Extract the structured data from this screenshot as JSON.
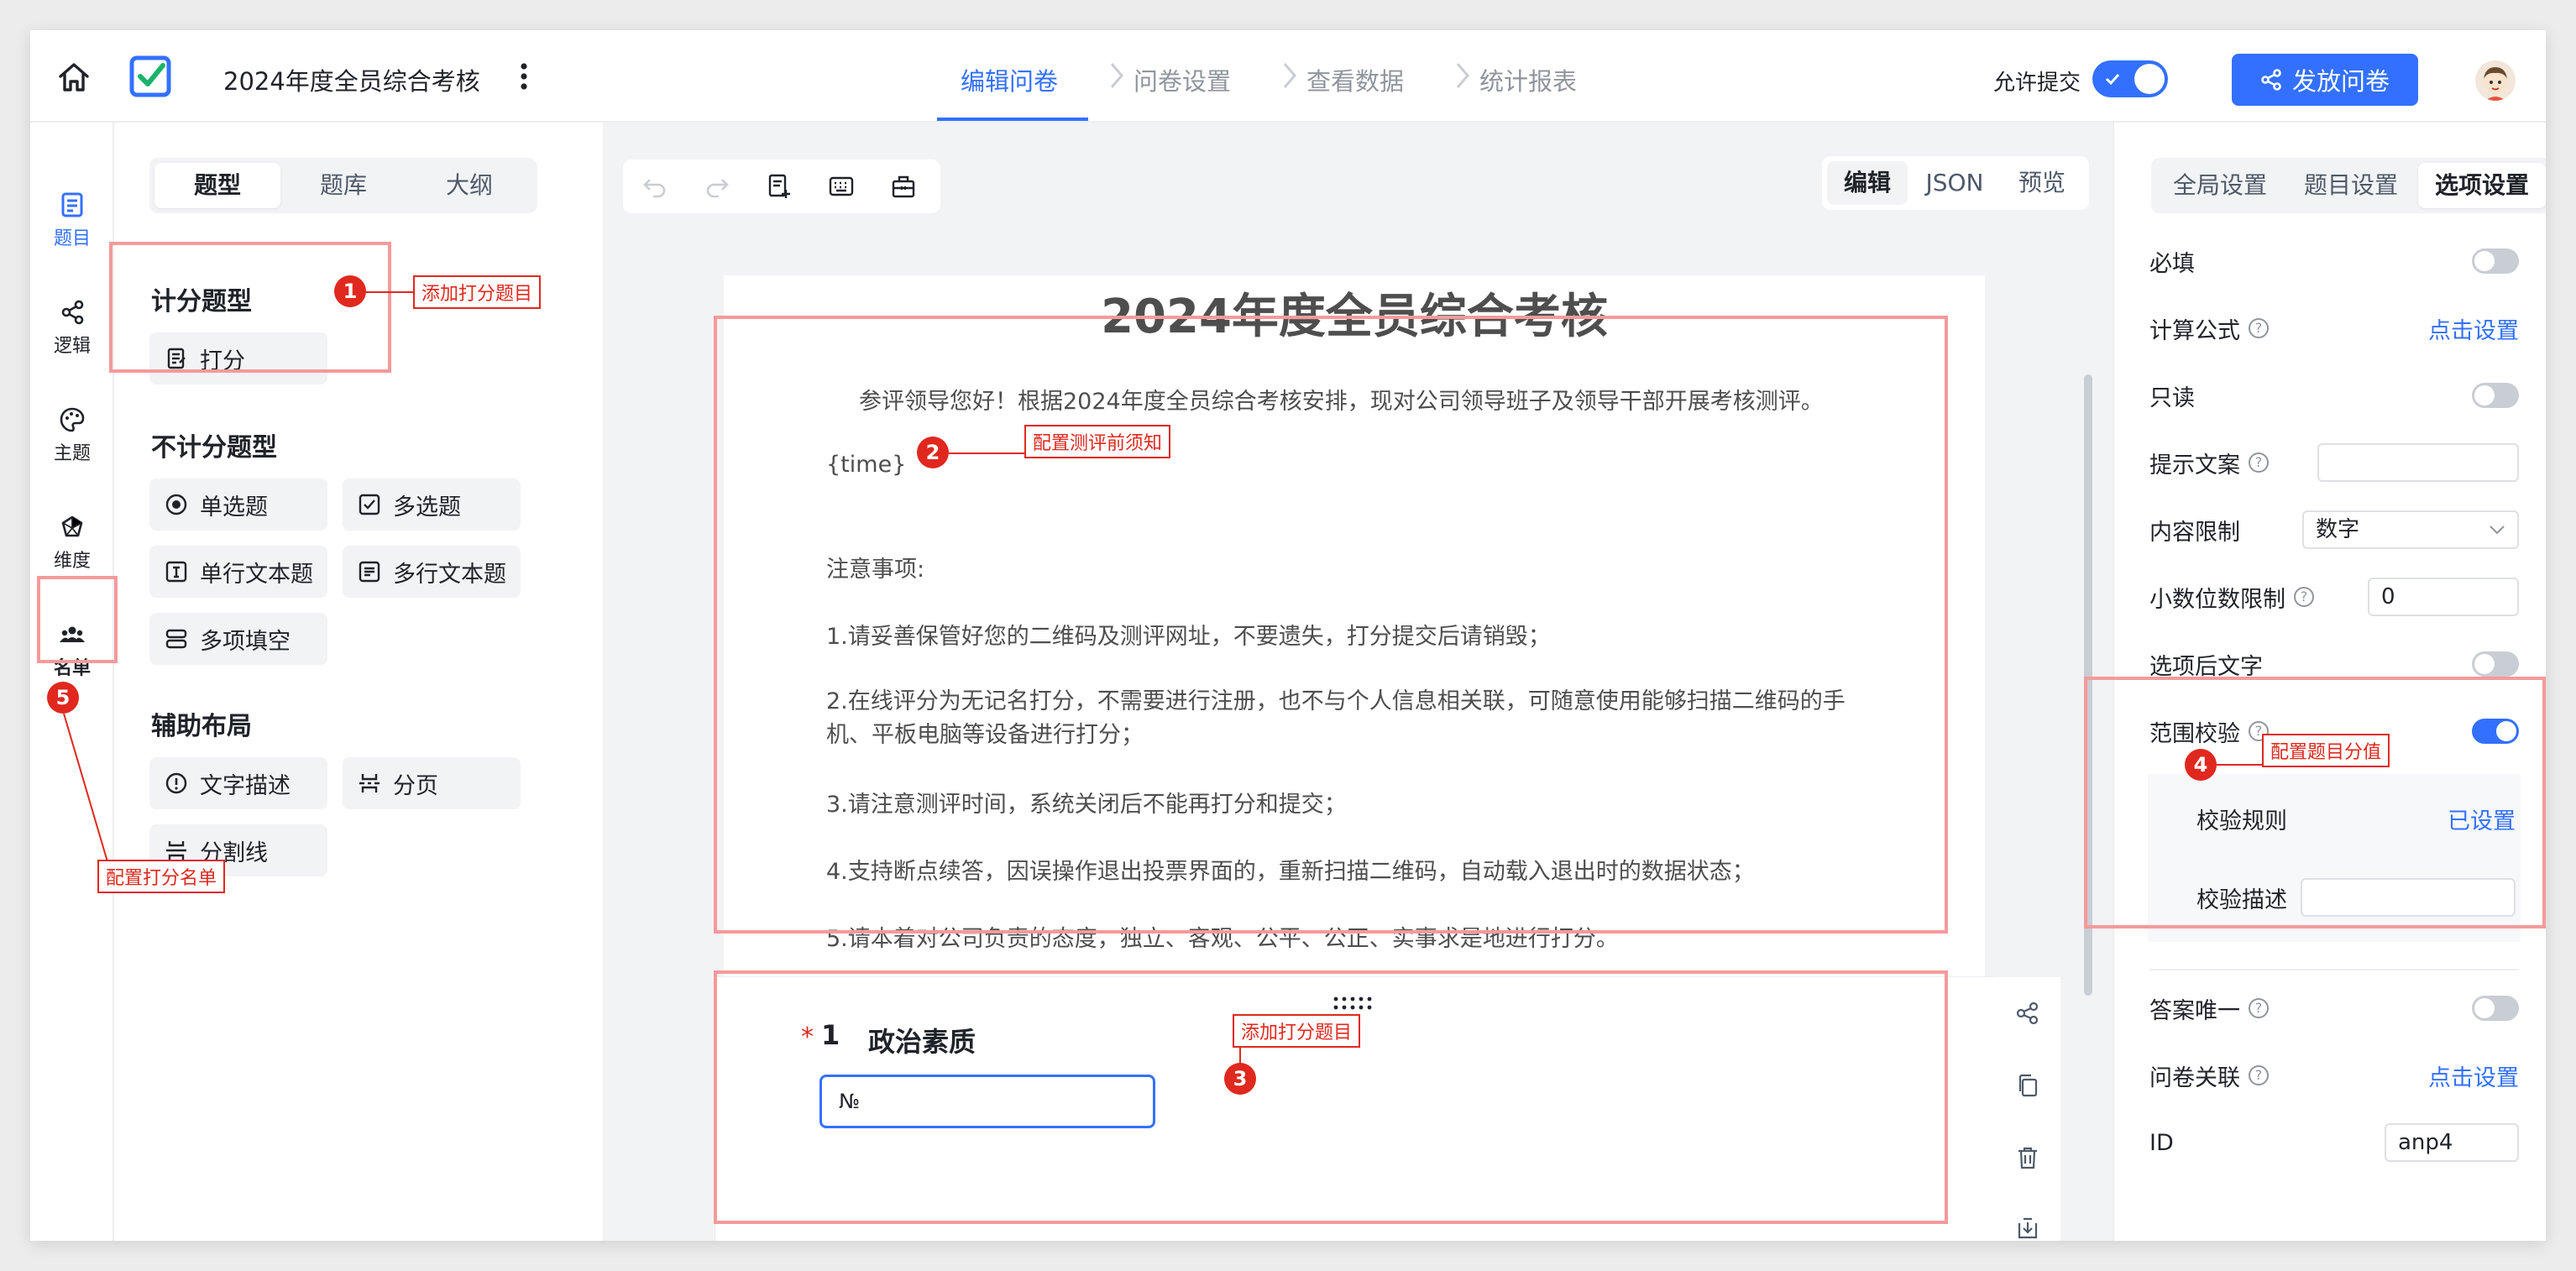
{
  "header": {
    "survey_title": "2024年度全员综合考核",
    "steps": [
      "编辑问卷",
      "问卷设置",
      "查看数据",
      "统计报表"
    ],
    "allow_submit_label": "允许提交",
    "publish_label": "发放问卷"
  },
  "rail": {
    "items": [
      "题目",
      "逻辑",
      "主题",
      "维度",
      "名单"
    ]
  },
  "widgets": {
    "tabs": [
      "题型",
      "题库",
      "大纲"
    ],
    "scored_title": "计分题型",
    "scored_items": [
      "打分"
    ],
    "unscored_title": "不计分题型",
    "unscored_items": [
      "单选题",
      "多选题",
      "单行文本题",
      "多行文本题",
      "多项填空"
    ],
    "layout_title": "辅助布局",
    "layout_items": [
      "文字描述",
      "分页",
      "分割线"
    ]
  },
  "canvas": {
    "view_tabs": [
      "编辑",
      "JSON",
      "预览"
    ],
    "paper_title": "2024年度全员综合考核",
    "intro": "参评领导您好！根据2024年度全员综合考核安排，现对公司领导班子及领导干部开展考核测评。",
    "time_placeholder": "{time}",
    "notes_title": "注意事项:",
    "notes": [
      "1.请妥善保管好您的二维码及测评网址，不要遗失，打分提交后请销毁；",
      "2.在线评分为无记名打分，不需要进行注册，也不与个人信息相关联，可随意使用能够扫描二维码的手机、平板电脑等设备进行打分；",
      "3.请注意测评时间，系统关闭后不能再打分和提交；",
      "4.支持断点续答，因误操作退出投票界面的，重新扫描二维码，自动载入退出时的数据状态；",
      "5.请本着对公司负责的态度，独立、客观、公平、公正、实事求是地进行打分。"
    ],
    "question": {
      "required_mark": "*",
      "number": "1",
      "title": "政治素质",
      "input_value": "№"
    }
  },
  "props": {
    "tabs": [
      "全局设置",
      "题目设置",
      "选项设置"
    ],
    "required_label": "必填",
    "formula_label": "计算公式",
    "formula_link": "点击设置",
    "readonly_label": "只读",
    "hint_label": "提示文案",
    "hint_value": "",
    "content_limit_label": "内容限制",
    "content_limit_value": "数字",
    "decimal_label": "小数位数限制",
    "decimal_value": "0",
    "suffix_label": "选项后文字",
    "range_label": "范围校验",
    "rule_label": "校验规则",
    "rule_value": "已设置",
    "desc_label": "校验描述",
    "desc_value": "",
    "unique_label": "答案唯一",
    "relate_label": "问卷关联",
    "relate_link": "点击设置",
    "id_label": "ID",
    "id_value": "anp4"
  },
  "annotations": {
    "a1": {
      "num": "1",
      "text": "添加打分题目"
    },
    "a2": {
      "num": "2",
      "text": "配置测评前须知"
    },
    "a3": {
      "num": "3",
      "text": "添加打分题目"
    },
    "a4": {
      "num": "4",
      "text": "配置题目分值"
    },
    "a5": {
      "num": "5",
      "text": "配置打分名单"
    }
  },
  "colors": {
    "accent": "#3370ff",
    "annotation": "#e0281e",
    "annotation_box": "#f59a9a"
  }
}
